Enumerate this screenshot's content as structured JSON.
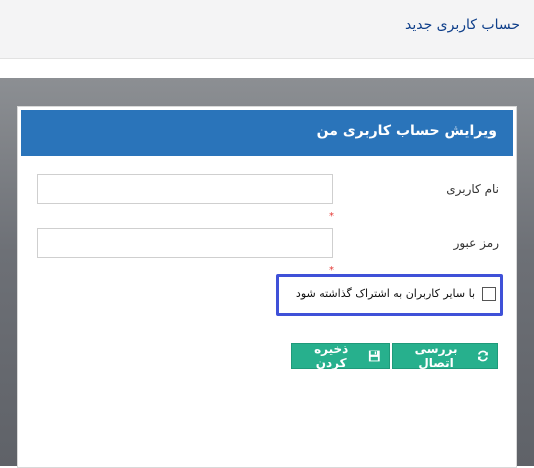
{
  "page": {
    "title": "حساب کاربری جدید"
  },
  "dialog": {
    "title": "ویرایش حساب کاربری من",
    "fields": {
      "username": {
        "label": "نام کاربری",
        "value": "",
        "required_mark": "*"
      },
      "password": {
        "label": "رمز عبور",
        "value": "",
        "required_mark": "*"
      }
    },
    "share": {
      "label": "با سایر کاربران به اشتراک گذاشته شود",
      "checked": false
    },
    "buttons": {
      "test_connection": {
        "label": "بررسی اتصال",
        "icon": "refresh-icon"
      },
      "save": {
        "label": "ذخیره کردن",
        "icon": "floppy-disk-icon"
      }
    }
  },
  "colors": {
    "header": "#2a74ba",
    "button": "#27b08d",
    "highlight": "#3f51d8",
    "required": "#e53935"
  }
}
